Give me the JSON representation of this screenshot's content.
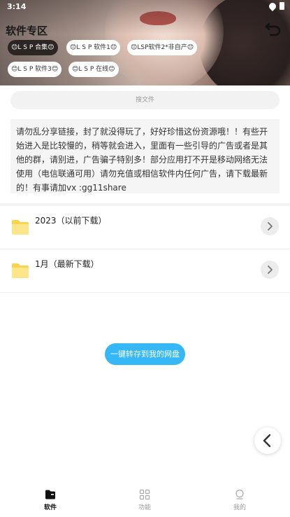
{
  "status_bar": {
    "time": "3:14"
  },
  "header": {
    "title": "软件专区",
    "tags": [
      {
        "label": "😊L S P 合集😊",
        "active": true
      },
      {
        "label": "😊L S P 软件1😊",
        "active": false
      },
      {
        "label": "😊LSP软件2*非自产😊",
        "active": false
      },
      {
        "label": "😊L S P 软件3😊",
        "active": false
      },
      {
        "label": "😊L S P 在线😊",
        "active": false
      }
    ]
  },
  "search": {
    "placeholder": "搜文件"
  },
  "notice": {
    "text": "请勿乱分享链接，封了就没得玩了，好好珍惜这份资源哦！！有些开始进入是比较慢的，稍等就会进入，里面有一些引导的广告或者是其他的群，请别进，广告骗子特别多！部分应用打不开是移动网络无法使用（电信联通可用）请勿充值或相信软件内任何广告，请下载最新的！有事请加vx :gg11share"
  },
  "folders": [
    {
      "name": "2023（以前下载）"
    },
    {
      "name": "1月（最新下载）"
    }
  ],
  "actions": {
    "save_to_drive": "一键转存到我的网盘"
  },
  "tabs": [
    {
      "label": "软件",
      "active": true
    },
    {
      "label": "功能",
      "active": false
    },
    {
      "label": "我的",
      "active": false
    }
  ],
  "colors": {
    "accent": "#35b8f5",
    "folder": "#fcd34d",
    "active_tag": "#2b2624"
  }
}
